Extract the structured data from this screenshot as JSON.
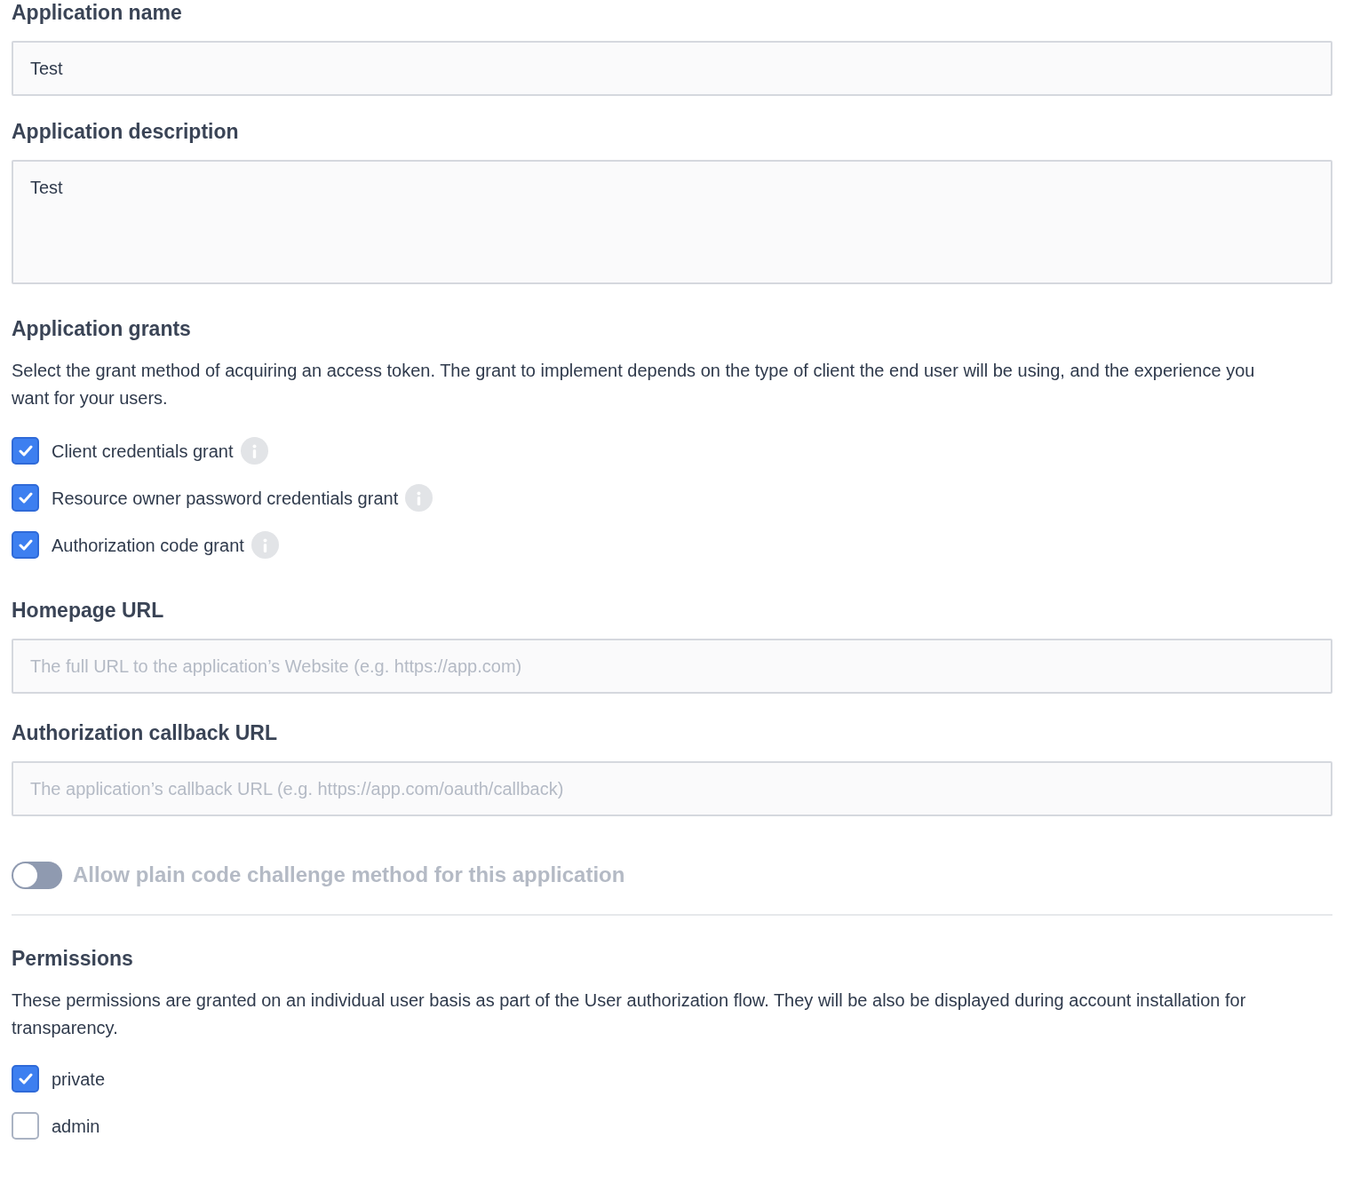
{
  "fields": [
    {
      "label": "Application name",
      "kind": "input",
      "value": "Test"
    },
    {
      "label": "Application description",
      "kind": "textarea",
      "value": "Test"
    }
  ],
  "grants": {
    "heading": "Application grants",
    "description": "Select the grant method of acquiring an access token. The grant to implement depends on the type of client the end user will be using, and the experience you want for your users.",
    "options": [
      {
        "label": "Client credentials grant",
        "checked": true,
        "info": true
      },
      {
        "label": "Resource owner password credentials grant",
        "checked": true,
        "info": true
      },
      {
        "label": "Authorization code grant",
        "checked": true,
        "info": true
      }
    ]
  },
  "urls": [
    {
      "label": "Homepage URL",
      "placeholder": "The full URL to the application’s Website (e.g. https://app.com)"
    },
    {
      "label": "Authorization callback URL",
      "placeholder": "The application’s callback URL (e.g. https://app.com/oauth/callback)"
    }
  ],
  "toggle": {
    "label": "Allow plain code challenge method for this application",
    "on": false,
    "disabled": true
  },
  "permissions": {
    "heading": "Permissions",
    "description": "These permissions are granted on an individual user basis as part of the User authorization flow. They will be also be displayed during account installation for transparency.",
    "options": [
      {
        "label": "private",
        "checked": true
      },
      {
        "label": "admin",
        "checked": false
      }
    ]
  }
}
